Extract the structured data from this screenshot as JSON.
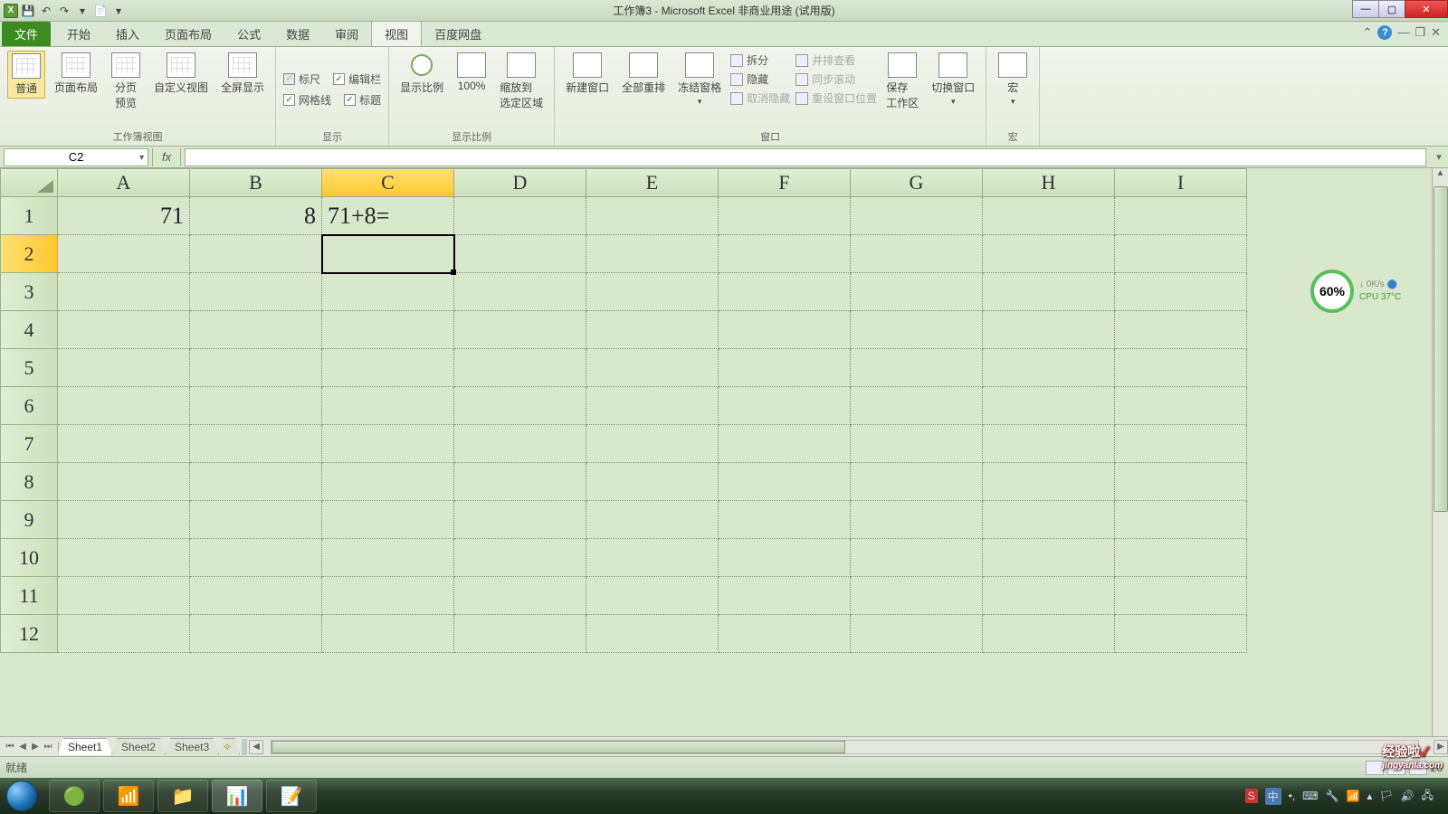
{
  "titlebar": {
    "title": "工作簿3 - Microsoft Excel 非商业用途 (试用版)"
  },
  "qat": {
    "save": "💾",
    "undo": "↶",
    "redo": "↷"
  },
  "tabs": {
    "file": "文件",
    "items": [
      "开始",
      "插入",
      "页面布局",
      "公式",
      "数据",
      "审阅",
      "视图",
      "百度网盘"
    ],
    "active": "视图"
  },
  "ribbon": {
    "group1": {
      "label": "工作簿视图",
      "normal": "普通",
      "pageLayout": "页面布局",
      "pageBreak": "分页\n预览",
      "custom": "自定义视图",
      "fullscreen": "全屏显示"
    },
    "group2": {
      "label": "显示",
      "ruler": "标尺",
      "formulaBar": "编辑栏",
      "gridlines": "网格线",
      "headings": "标题"
    },
    "group3": {
      "label": "显示比例",
      "zoom": "显示比例",
      "z100": "100%",
      "zoomSel": "缩放到\n选定区域"
    },
    "group4": {
      "label": "窗口",
      "newWin": "新建窗口",
      "arrange": "全部重排",
      "freeze": "冻结窗格",
      "split": "拆分",
      "hide": "隐藏",
      "unhide": "取消隐藏",
      "sideBySide": "并排查看",
      "syncScroll": "同步滚动",
      "resetPos": "重设窗口位置",
      "saveWs": "保存\n工作区",
      "switchWin": "切换窗口"
    },
    "group5": {
      "label": "宏",
      "macros": "宏"
    }
  },
  "nameBox": "C2",
  "formula": "",
  "columns": [
    "A",
    "B",
    "C",
    "D",
    "E",
    "F",
    "G",
    "H",
    "I"
  ],
  "activeCol": "C",
  "activeRow": 2,
  "rowCount": 12,
  "cells": {
    "A1": "71",
    "B1": "8",
    "C1": "71+8="
  },
  "selectedCell": "C2",
  "monitor": {
    "pct": "60%",
    "net": "0K/s",
    "cpuLabel": "CPU",
    "cpuTemp": "37°C"
  },
  "sheets": {
    "active": "Sheet1",
    "list": [
      "Sheet1",
      "Sheet2",
      "Sheet3"
    ]
  },
  "status": {
    "ready": "就绪",
    "zoom": "20"
  },
  "watermark": {
    "main": "经验啦",
    "sub": "jingyanla.com"
  },
  "tray": {
    "time": ""
  }
}
